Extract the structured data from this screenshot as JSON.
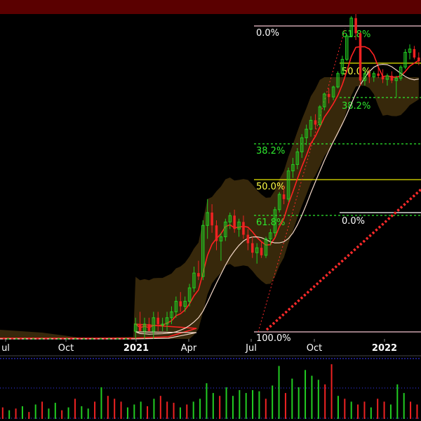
{
  "colors": {
    "background": "#000000",
    "top_bar": "#5a0000",
    "up_candle": "#22cc22",
    "down_candle": "#ee2222",
    "band_fill": "#3a2a0c",
    "fib_upper_line": "#f2c3ce",
    "fib_mid_line": "#e6e600",
    "fib_green": "#2ee82e",
    "fib_white": "#ffffff",
    "fib_yellow": "#ffff44",
    "ma_red": "#ff2222",
    "ma_white": "#f4d8c8",
    "trend_dotted": "#ff2a2a",
    "separator_dotted": "#3a3aff",
    "volume_grid": "#3a3aff"
  },
  "chart_data": {
    "type": "candlestick-with-volume",
    "x_axis": {
      "tick_labels": [
        {
          "label": "ul",
          "date": "2020-07",
          "bold": false
        },
        {
          "label": "Oct",
          "date": "2020-10",
          "bold": false
        },
        {
          "label": "2021",
          "date": "2021-01",
          "bold": true
        },
        {
          "label": "Apr",
          "date": "2021-04",
          "bold": false
        },
        {
          "label": "Jul",
          "date": "2021-07",
          "bold": false
        },
        {
          "label": "Oct",
          "date": "2021-10",
          "bold": false
        },
        {
          "label": "2022",
          "date": "2022-01",
          "bold": true
        }
      ]
    },
    "fibonacci_left": [
      {
        "label": "0.0%",
        "color": "white",
        "level": 0.0
      },
      {
        "label": "38.2%",
        "color": "green",
        "level": 0.382
      },
      {
        "label": "50.0%",
        "color": "yellow",
        "level": 0.5
      },
      {
        "label": "61.8%",
        "color": "green",
        "level": 0.618
      },
      {
        "label": "100.0%",
        "color": "white",
        "level": 1.0
      }
    ],
    "fibonacci_right": [
      {
        "label": "61.8%",
        "color": "green"
      },
      {
        "label": "50.0%",
        "color": "yellow"
      },
      {
        "label": "38.2%",
        "color": "green"
      },
      {
        "label": "0.0%",
        "color": "white"
      }
    ],
    "price_candles": [
      {
        "o": 1.0,
        "h": 1.2,
        "l": 0.9,
        "c": 1.1
      },
      {
        "o": 1.1,
        "h": 1.3,
        "l": 1.0,
        "c": 1.0
      },
      {
        "o": 1.0,
        "h": 1.2,
        "l": 0.9,
        "c": 1.1
      },
      {
        "o": 1.1,
        "h": 1.2,
        "l": 1.0,
        "c": 1.0
      },
      {
        "o": 1.0,
        "h": 1.3,
        "l": 0.9,
        "c": 1.2
      },
      {
        "o": 1.2,
        "h": 1.3,
        "l": 1.0,
        "c": 1.1
      },
      {
        "o": 1.1,
        "h": 1.2,
        "l": 1.0,
        "c": 1.1
      },
      {
        "o": 1.1,
        "h": 1.3,
        "l": 1.0,
        "c": 1.2
      },
      {
        "o": 1.2,
        "h": 1.4,
        "l": 1.1,
        "c": 1.3
      },
      {
        "o": 1.3,
        "h": 1.6,
        "l": 1.2,
        "c": 1.5
      },
      {
        "o": 1.5,
        "h": 1.7,
        "l": 1.3,
        "c": 1.4
      },
      {
        "o": 1.4,
        "h": 1.6,
        "l": 1.3,
        "c": 1.5
      },
      {
        "o": 1.5,
        "h": 1.9,
        "l": 1.4,
        "c": 1.8
      },
      {
        "o": 1.8,
        "h": 2.4,
        "l": 1.7,
        "c": 2.2
      },
      {
        "o": 2.2,
        "h": 2.6,
        "l": 2.0,
        "c": 2.1
      },
      {
        "o": 2.1,
        "h": 4.5,
        "l": 2.0,
        "c": 4.2
      },
      {
        "o": 4.2,
        "h": 6.0,
        "l": 3.5,
        "c": 5.0
      },
      {
        "o": 5.0,
        "h": 5.6,
        "l": 3.8,
        "c": 4.2
      },
      {
        "o": 4.2,
        "h": 4.5,
        "l": 3.0,
        "c": 3.4
      },
      {
        "o": 3.4,
        "h": 3.8,
        "l": 2.6,
        "c": 3.6
      },
      {
        "o": 3.6,
        "h": 4.6,
        "l": 3.4,
        "c": 4.4
      },
      {
        "o": 4.4,
        "h": 5.0,
        "l": 4.0,
        "c": 4.8
      },
      {
        "o": 4.8,
        "h": 5.2,
        "l": 3.8,
        "c": 4.0
      },
      {
        "o": 4.0,
        "h": 4.6,
        "l": 3.6,
        "c": 4.4
      },
      {
        "o": 4.4,
        "h": 4.8,
        "l": 3.5,
        "c": 3.7
      },
      {
        "o": 3.7,
        "h": 4.0,
        "l": 3.0,
        "c": 3.3
      },
      {
        "o": 3.3,
        "h": 3.6,
        "l": 2.7,
        "c": 2.9
      },
      {
        "o": 2.9,
        "h": 3.3,
        "l": 2.5,
        "c": 3.1
      },
      {
        "o": 3.1,
        "h": 3.4,
        "l": 2.7,
        "c": 2.8
      },
      {
        "o": 2.8,
        "h": 3.6,
        "l": 2.7,
        "c": 3.5
      },
      {
        "o": 3.5,
        "h": 4.0,
        "l": 3.2,
        "c": 3.8
      },
      {
        "o": 3.8,
        "h": 5.4,
        "l": 3.6,
        "c": 5.2
      },
      {
        "o": 5.2,
        "h": 6.6,
        "l": 5.0,
        "c": 6.4
      },
      {
        "o": 6.4,
        "h": 7.2,
        "l": 5.6,
        "c": 6.0
      },
      {
        "o": 6.0,
        "h": 9.2,
        "l": 5.8,
        "c": 8.8
      },
      {
        "o": 8.8,
        "h": 10.5,
        "l": 8.0,
        "c": 9.6
      },
      {
        "o": 9.6,
        "h": 12.0,
        "l": 9.0,
        "c": 11.4
      },
      {
        "o": 11.4,
        "h": 14.5,
        "l": 10.5,
        "c": 13.8
      },
      {
        "o": 13.8,
        "h": 16.5,
        "l": 12.5,
        "c": 15.5
      },
      {
        "o": 15.5,
        "h": 18.5,
        "l": 14.0,
        "c": 17.5
      },
      {
        "o": 17.5,
        "h": 19.0,
        "l": 15.5,
        "c": 16.5
      },
      {
        "o": 16.5,
        "h": 21.5,
        "l": 16.0,
        "c": 21.0
      },
      {
        "o": 21.0,
        "h": 25.5,
        "l": 20.0,
        "c": 25.0
      },
      {
        "o": 25.0,
        "h": 27.0,
        "l": 22.0,
        "c": 24.0
      },
      {
        "o": 24.0,
        "h": 28.0,
        "l": 23.0,
        "c": 27.5
      },
      {
        "o": 27.5,
        "h": 34.0,
        "l": 27.0,
        "c": 33.0
      },
      {
        "o": 33.0,
        "h": 42.0,
        "l": 32.0,
        "c": 40.0
      },
      {
        "o": 40.0,
        "h": 56.0,
        "l": 39.0,
        "c": 55.0
      },
      {
        "o": 55.0,
        "h": 72.0,
        "l": 54.0,
        "c": 70.0
      },
      {
        "o": 70.0,
        "h": 74.0,
        "l": 52.0,
        "c": 57.0
      },
      {
        "o": 57.0,
        "h": 58.0,
        "l": 28.0,
        "c": 30.0
      },
      {
        "o": 30.0,
        "h": 36.0,
        "l": 28.0,
        "c": 33.0
      },
      {
        "o": 33.0,
        "h": 35.0,
        "l": 29.0,
        "c": 31.5
      },
      {
        "o": 31.5,
        "h": 34.0,
        "l": 29.5,
        "c": 33.0
      },
      {
        "o": 33.0,
        "h": 36.0,
        "l": 31.0,
        "c": 32.0
      },
      {
        "o": 32.0,
        "h": 35.0,
        "l": 29.0,
        "c": 30.5
      },
      {
        "o": 30.5,
        "h": 33.0,
        "l": 28.0,
        "c": 32.0
      },
      {
        "o": 32.0,
        "h": 34.0,
        "l": 29.0,
        "c": 30.0
      },
      {
        "o": 30.0,
        "h": 32.0,
        "l": 24.0,
        "c": 31.0
      },
      {
        "o": 31.0,
        "h": 37.0,
        "l": 30.0,
        "c": 36.0
      },
      {
        "o": 36.0,
        "h": 46.0,
        "l": 35.0,
        "c": 44.0
      },
      {
        "o": 44.0,
        "h": 49.0,
        "l": 40.0,
        "c": 46.0
      },
      {
        "o": 46.0,
        "h": 48.0,
        "l": 40.0,
        "c": 41.0
      },
      {
        "o": 41.0,
        "h": 44.0,
        "l": 37.0,
        "c": 39.0
      }
    ],
    "volume_bars": [
      {
        "v": 0.2,
        "up": false
      },
      {
        "v": 0.15,
        "up": true
      },
      {
        "v": 0.18,
        "up": false
      },
      {
        "v": 0.22,
        "up": true
      },
      {
        "v": 0.12,
        "up": false
      },
      {
        "v": 0.25,
        "up": true
      },
      {
        "v": 0.3,
        "up": false
      },
      {
        "v": 0.18,
        "up": true
      },
      {
        "v": 0.28,
        "up": true
      },
      {
        "v": 0.15,
        "up": false
      },
      {
        "v": 0.2,
        "up": true
      },
      {
        "v": 0.35,
        "up": false
      },
      {
        "v": 0.22,
        "up": true
      },
      {
        "v": 0.18,
        "up": true
      },
      {
        "v": 0.3,
        "up": false
      },
      {
        "v": 0.55,
        "up": true
      },
      {
        "v": 0.4,
        "up": false
      },
      {
        "v": 0.35,
        "up": false
      },
      {
        "v": 0.3,
        "up": false
      },
      {
        "v": 0.2,
        "up": true
      },
      {
        "v": 0.25,
        "up": true
      },
      {
        "v": 0.3,
        "up": true
      },
      {
        "v": 0.22,
        "up": false
      },
      {
        "v": 0.35,
        "up": true
      },
      {
        "v": 0.4,
        "up": false
      },
      {
        "v": 0.3,
        "up": false
      },
      {
        "v": 0.28,
        "up": false
      },
      {
        "v": 0.2,
        "up": true
      },
      {
        "v": 0.25,
        "up": false
      },
      {
        "v": 0.3,
        "up": true
      },
      {
        "v": 0.35,
        "up": true
      },
      {
        "v": 0.62,
        "up": true
      },
      {
        "v": 0.45,
        "up": true
      },
      {
        "v": 0.4,
        "up": false
      },
      {
        "v": 0.55,
        "up": true
      },
      {
        "v": 0.4,
        "up": true
      },
      {
        "v": 0.5,
        "up": true
      },
      {
        "v": 0.45,
        "up": true
      },
      {
        "v": 0.5,
        "up": true
      },
      {
        "v": 0.48,
        "up": true
      },
      {
        "v": 0.35,
        "up": false
      },
      {
        "v": 0.58,
        "up": true
      },
      {
        "v": 0.92,
        "up": true
      },
      {
        "v": 0.45,
        "up": false
      },
      {
        "v": 0.7,
        "up": true
      },
      {
        "v": 0.55,
        "up": true
      },
      {
        "v": 0.85,
        "up": true
      },
      {
        "v": 0.75,
        "up": true
      },
      {
        "v": 0.68,
        "up": true
      },
      {
        "v": 0.6,
        "up": false
      },
      {
        "v": 0.95,
        "up": false
      },
      {
        "v": 0.4,
        "up": true
      },
      {
        "v": 0.35,
        "up": false
      },
      {
        "v": 0.3,
        "up": true
      },
      {
        "v": 0.25,
        "up": false
      },
      {
        "v": 0.3,
        "up": false
      },
      {
        "v": 0.2,
        "up": true
      },
      {
        "v": 0.35,
        "up": false
      },
      {
        "v": 0.3,
        "up": false
      },
      {
        "v": 0.25,
        "up": true
      },
      {
        "v": 0.6,
        "up": true
      },
      {
        "v": 0.45,
        "up": true
      },
      {
        "v": 0.3,
        "up": false
      },
      {
        "v": 0.25,
        "up": false
      }
    ]
  }
}
